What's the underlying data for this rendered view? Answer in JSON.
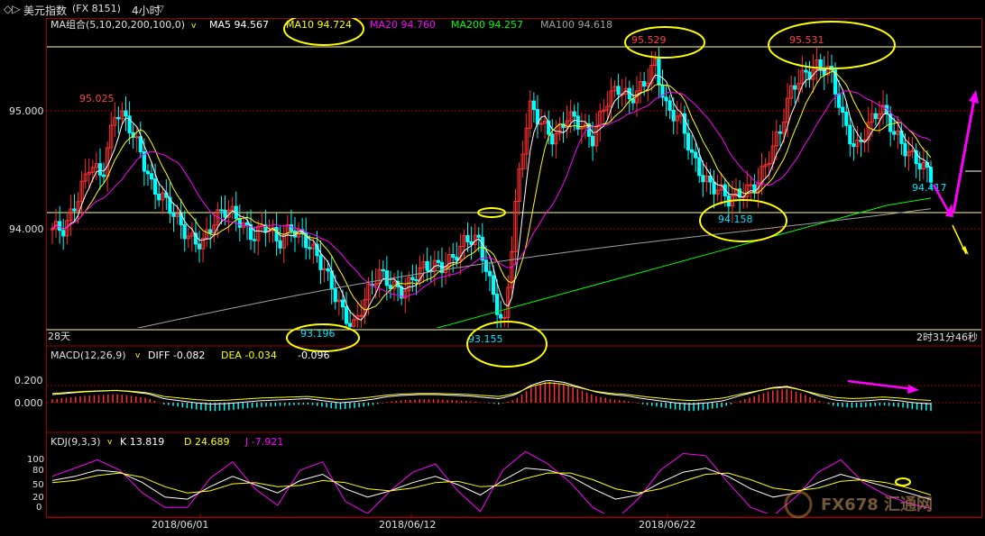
{
  "header": {
    "nav_glyph": "◇▷",
    "title": "美元指数",
    "symbol": "(FX 8151)",
    "period": "4小时",
    "period_arrow": "▽"
  },
  "ma_legend": {
    "label": "MA组合(5,10,20,200,100,0)",
    "items": [
      {
        "text": "MA5 94.567",
        "color": "#ffffff"
      },
      {
        "text": "MA10 94.724",
        "color": "#ffff00"
      },
      {
        "text": "MA20 94.760",
        "color": "#ff00ff"
      },
      {
        "text": "MA200 94.257",
        "color": "#00ff00"
      },
      {
        "text": "MA100 94.618",
        "color": "#a0a0a0"
      }
    ]
  },
  "price_axis": {
    "labels": [
      "95.000",
      "94.000"
    ],
    "values": [
      95.0,
      94.0
    ]
  },
  "annotations": [
    {
      "text": "95.025",
      "color": "#ff4040"
    },
    {
      "text": "95.529",
      "color": "#ff4040"
    },
    {
      "text": "95.531",
      "color": "#ff4040"
    },
    {
      "text": "94.158",
      "color": "#00e5ff"
    },
    {
      "text": "93.196",
      "color": "#00e5ff"
    },
    {
      "text": "93.155",
      "color": "#00e5ff"
    },
    {
      "text": "94.417",
      "color": "#00e5ff"
    }
  ],
  "status": {
    "left": "28天",
    "right": "2时31分46秒"
  },
  "macd": {
    "label": "MACD(12,26,9)",
    "diff": "DIFF -0.082",
    "dea": "DEA -0.034",
    "macd_value": "-0.096",
    "axis_labels": [
      "0.200",
      "0.000"
    ]
  },
  "kdj": {
    "label": "KDJ(9,3,3)",
    "k": "K 13.819",
    "d": "D 24.689",
    "j": "J -7.921",
    "axis_labels": [
      "100",
      "80",
      "50",
      "20",
      "0"
    ]
  },
  "dates": [
    "2018/06/01",
    "2018/06/12",
    "2018/06/22"
  ],
  "watermark": "FX678 汇通网",
  "colors": {
    "up": "#ff3030",
    "down": "#00ffff",
    "ma5": "#ffffff",
    "ma10": "#ffff00",
    "ma20": "#ff00ff",
    "ma200": "#00ff00",
    "ma100": "#a0a0a0",
    "circle": "#ffff00",
    "arrow_magenta": "#ff00ff",
    "grid_red": "#9a0000"
  },
  "chart_data": {
    "type": "candlestick",
    "price_series": [
      94.0,
      93.95,
      94.25,
      94.6,
      94.45,
      94.95,
      94.9,
      94.7,
      94.35,
      94.2,
      94.05,
      93.95,
      93.9,
      94.05,
      94.15,
      94.1,
      93.95,
      94.0,
      93.85,
      94.05,
      93.95,
      93.75,
      93.55,
      93.35,
      93.2,
      93.4,
      93.6,
      93.55,
      93.5,
      93.6,
      93.65,
      93.7,
      93.8,
      93.9,
      93.85,
      93.5,
      93.2,
      94.3,
      95.0,
      94.9,
      94.8,
      94.95,
      94.85,
      94.75,
      95.1,
      95.2,
      95.05,
      95.2,
      95.45,
      95.0,
      94.9,
      94.6,
      94.45,
      94.35,
      94.2,
      94.3,
      94.4,
      94.6,
      94.8,
      95.2,
      95.35,
      95.4,
      95.3,
      94.9,
      94.7,
      94.9,
      95.0,
      94.8,
      94.7,
      94.6,
      94.42
    ],
    "ma200_series": [
      92.9,
      93.0,
      93.1,
      93.2,
      93.3,
      93.4,
      93.5,
      93.6,
      93.7,
      93.8,
      93.9,
      94.0,
      94.1,
      94.2,
      94.26
    ],
    "macd_hist": [
      0.04,
      0.06,
      0.08,
      0.09,
      0.1,
      0.08,
      0.05,
      -0.02,
      -0.05,
      -0.08,
      -0.1,
      -0.09,
      -0.07,
      -0.05,
      -0.04,
      -0.03,
      -0.02,
      -0.05,
      -0.08,
      -0.06,
      -0.03,
      0.01,
      0.03,
      0.04,
      0.04,
      0.03,
      0.02,
      0.0,
      -0.02,
      0.04,
      0.18,
      0.25,
      0.22,
      0.15,
      0.08,
      0.04,
      0.02,
      -0.02,
      -0.05,
      -0.08,
      -0.1,
      -0.08,
      -0.05,
      0.02,
      0.08,
      0.14,
      0.16,
      0.1,
      0.02,
      -0.04,
      -0.06,
      -0.05,
      -0.03,
      -0.05,
      -0.08,
      -0.096
    ],
    "kdj_series": {
      "k": [
        60,
        70,
        85,
        80,
        55,
        20,
        15,
        45,
        70,
        50,
        30,
        60,
        75,
        40,
        20,
        35,
        55,
        70,
        50,
        25,
        60,
        90,
        85,
        70,
        40,
        15,
        25,
        55,
        80,
        90,
        70,
        40,
        20,
        30,
        55,
        75,
        60,
        45,
        30,
        14
      ],
      "d": [
        55,
        60,
        72,
        78,
        68,
        45,
        30,
        35,
        52,
        55,
        45,
        48,
        60,
        55,
        40,
        35,
        42,
        55,
        58,
        45,
        48,
        65,
        78,
        78,
        62,
        40,
        30,
        40,
        58,
        75,
        78,
        62,
        42,
        35,
        42,
        58,
        62,
        55,
        42,
        25
      ],
      "j": [
        70,
        90,
        110,
        85,
        30,
        -5,
        -5,
        65,
        105,
        40,
        0,
        85,
        105,
        10,
        -20,
        35,
        80,
        100,
        35,
        -15,
        85,
        130,
        100,
        55,
        -5,
        -35,
        15,
        85,
        125,
        120,
        55,
        -5,
        -25,
        20,
        80,
        110,
        55,
        25,
        5,
        -8
      ]
    }
  }
}
